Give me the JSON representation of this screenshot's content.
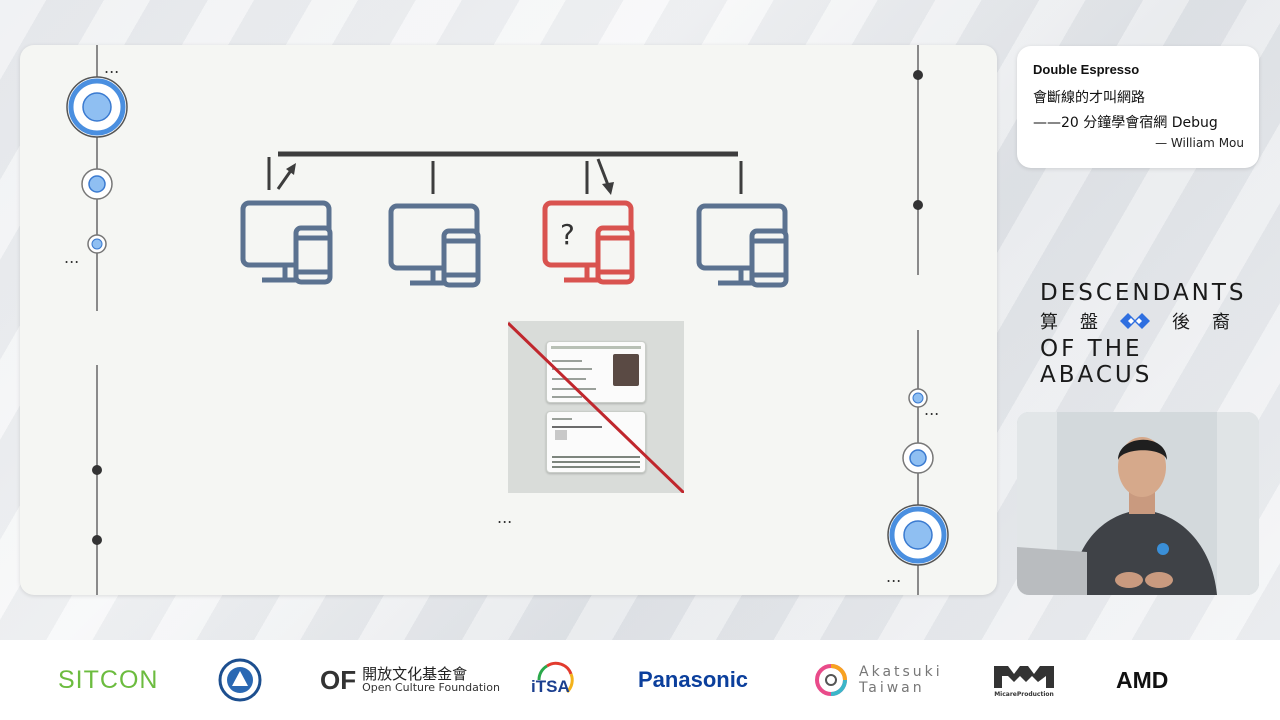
{
  "slide": {
    "ellipsis": "..."
  },
  "network": {
    "question_mark": "?"
  },
  "talk": {
    "series": "Double Espresso",
    "title_line1": "會斷線的才叫網路",
    "title_line2": "——20 分鐘學會宿網 Debug",
    "speaker": "— William Mou"
  },
  "brand": {
    "line1": "DESCENDANTS",
    "line2_left": [
      "算",
      "盤"
    ],
    "line2_right": [
      "後",
      "裔"
    ],
    "line3": "OF THE ABACUS"
  },
  "colors": {
    "device_normal": "#5b7290",
    "device_alert": "#d9534f",
    "accent_blue": "#4a8fe0",
    "sitcon_green": "#6cbc3f",
    "panasonic_blue": "#0b3f9c"
  },
  "sponsors": {
    "sitcon": "SITCON",
    "ocf_mark": "OF",
    "ocf_zh": "開放文化基金會",
    "ocf_en": "Open Culture Foundation",
    "itsa": "iTSA",
    "panasonic": "Panasonic",
    "akatsuki_line1": "Akatsuki",
    "akatsuki_line2": "Taiwan",
    "micare": "MicareProduction",
    "amd": "AMD"
  }
}
